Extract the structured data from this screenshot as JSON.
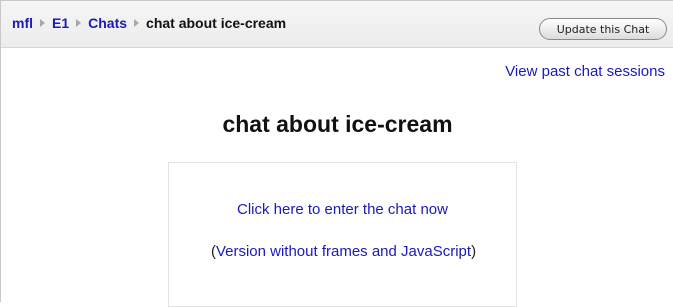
{
  "breadcrumb": {
    "items": [
      "mfl",
      "E1",
      "Chats"
    ],
    "current": "chat about ice-cream"
  },
  "header": {
    "update_button_label": "Update this Chat"
  },
  "links": {
    "past_sessions": "View past chat sessions"
  },
  "main": {
    "title": "chat about ice-cream",
    "enter_chat": "Click here to enter the chat now",
    "noframes_open": "(",
    "noframes_link": "Version without frames and JavaScript",
    "noframes_close": ")"
  },
  "colors": {
    "link": "#1a1ab8",
    "navbar_bg": "#ececec"
  }
}
